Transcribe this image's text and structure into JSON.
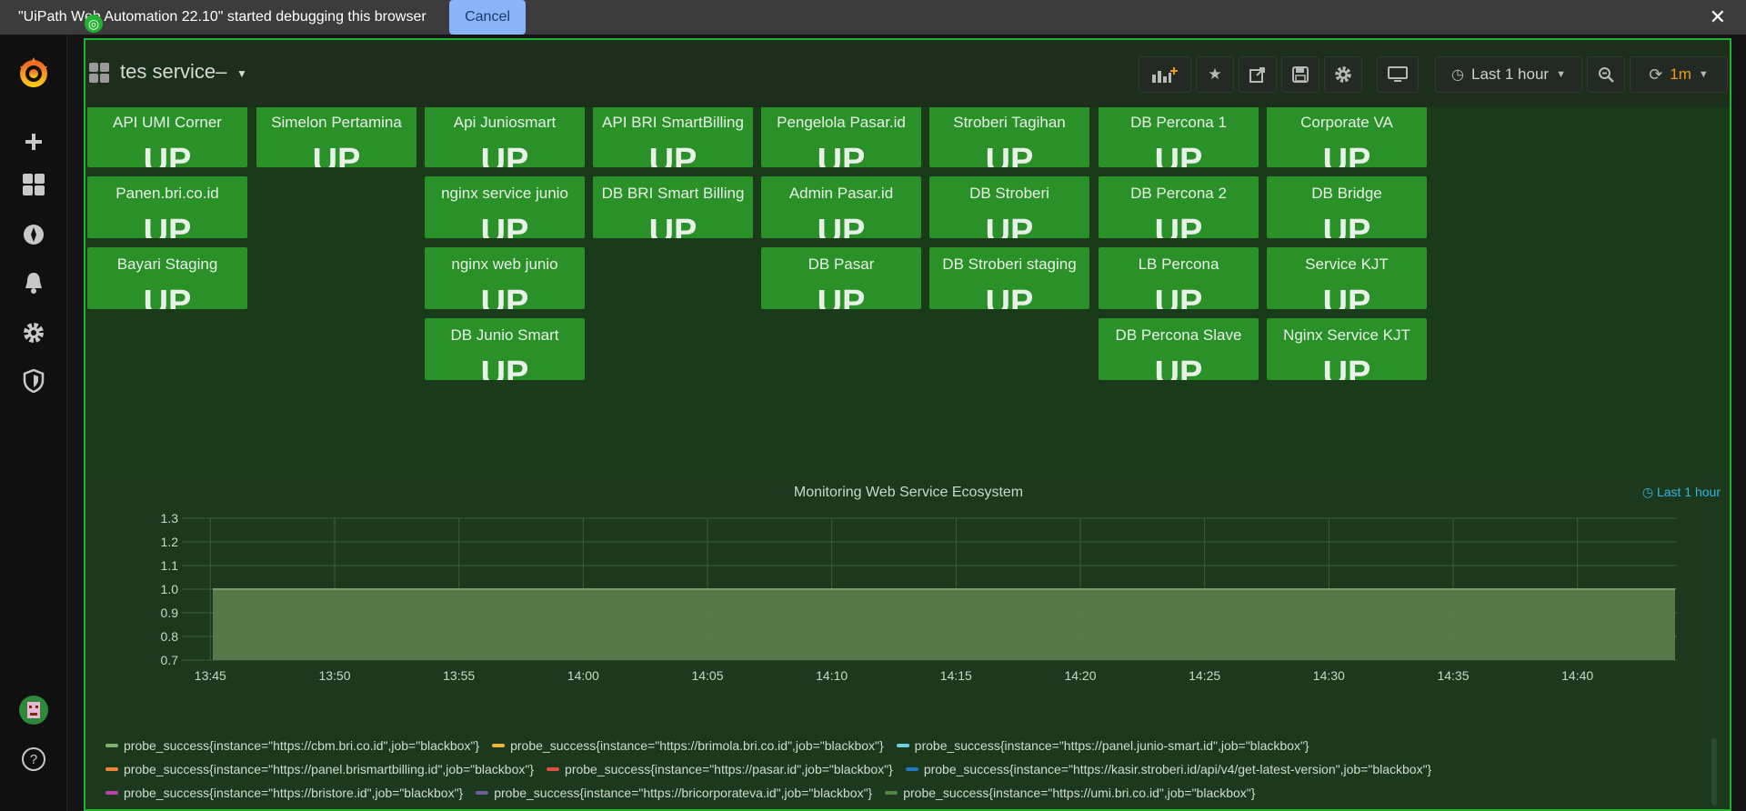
{
  "banner": {
    "message": "\"UiPath Web Automation 22.10\" started debugging this browser",
    "cancel_label": "Cancel",
    "close_label": "✕"
  },
  "navbar": {
    "dashboard_title": "tes service–",
    "time_range_label": "Last 1 hour",
    "refresh_interval": "1m"
  },
  "panels": [
    {
      "title": "",
      "value": "UP"
    },
    {
      "title": "",
      "value": "UP"
    },
    {
      "title": "",
      "value": "UP"
    },
    {
      "title": "",
      "value": "UP"
    },
    {
      "title": "",
      "value": "UP"
    },
    {
      "title": "",
      "value": "UP"
    },
    {
      "title": "",
      "value": "UP"
    },
    {
      "title": "",
      "value": "UP"
    },
    {
      "title": "API UMI Corner",
      "value": "UP"
    },
    {
      "title": "Simelon Pertamina",
      "value": "UP"
    },
    {
      "title": "Api Juniosmart",
      "value": "UP"
    },
    {
      "title": "API BRI SmartBilling",
      "value": "UP"
    },
    {
      "title": "Pengelola Pasar.id",
      "value": "UP"
    },
    {
      "title": "Stroberi Tagihan",
      "value": "UP"
    },
    {
      "title": "DB Percona 1",
      "value": "UP"
    },
    {
      "title": "Corporate VA",
      "value": "UP"
    },
    {
      "title": "Panen.bri.co.id",
      "value": "UP"
    },
    {
      "title": "nginx service junio",
      "value": "UP"
    },
    {
      "title": "DB BRI Smart Billing",
      "value": "UP"
    },
    {
      "title": "Admin Pasar.id",
      "value": "UP"
    },
    {
      "title": "DB Stroberi",
      "value": "UP"
    },
    {
      "title": "DB Percona 2",
      "value": "UP"
    },
    {
      "title": "DB Bridge",
      "value": "UP"
    },
    {
      "title": "Bayari Staging",
      "value": "UP"
    },
    {
      "title": "nginx web junio",
      "value": "UP"
    },
    {
      "title": "DB Pasar",
      "value": "UP"
    },
    {
      "title": "DB Stroberi staging",
      "value": "UP"
    },
    {
      "title": "LB Percona",
      "value": "UP"
    },
    {
      "title": "Service KJT",
      "value": "UP"
    },
    {
      "title": "DB Junio Smart",
      "value": "UP"
    },
    {
      "title": "DB Percona Slave",
      "value": "UP"
    },
    {
      "title": "Nginx Service KJT",
      "value": "UP"
    }
  ],
  "graph": {
    "title": "Monitoring Web Service Ecosystem",
    "range_label": "Last 1 hour",
    "fill_color": "#5a7a4a",
    "legend": [
      {
        "label": "probe_success{instance=\"https://cbm.bri.co.id\",job=\"blackbox\"}",
        "color": "#7eb26d"
      },
      {
        "label": "probe_success{instance=\"https://brimola.bri.co.id\",job=\"blackbox\"}",
        "color": "#eab839"
      },
      {
        "label": "probe_success{instance=\"https://panel.junio-smart.id\",job=\"blackbox\"}",
        "color": "#6ed0e0"
      },
      {
        "label": "probe_success{instance=\"https://panel.brismartbilling.id\",job=\"blackbox\"}",
        "color": "#ef843c"
      },
      {
        "label": "probe_success{instance=\"https://pasar.id\",job=\"blackbox\"}",
        "color": "#e24d42"
      },
      {
        "label": "probe_success{instance=\"https://kasir.stroberi.id/api/v4/get-latest-version\",job=\"blackbox\"}",
        "color": "#1f78c1"
      },
      {
        "label": "probe_success{instance=\"https://bristore.id\",job=\"blackbox\"}",
        "color": "#ba43a9"
      },
      {
        "label": "probe_success{instance=\"https://bricorporateva.id\",job=\"blackbox\"}",
        "color": "#705da0"
      },
      {
        "label": "probe_success{instance=\"https://umi.bri.co.id\",job=\"blackbox\"}",
        "color": "#508642"
      }
    ]
  },
  "chart_data": {
    "type": "area",
    "title": "Monitoring Web Service Ecosystem",
    "x_ticks": [
      "13:45",
      "13:50",
      "13:55",
      "14:00",
      "14:05",
      "14:10",
      "14:15",
      "14:20",
      "14:25",
      "14:30",
      "14:35",
      "14:40"
    ],
    "y_ticks": [
      "1.3",
      "1.2",
      "1.1",
      "1.0",
      "0.9",
      "0.8",
      "0.7"
    ],
    "ylim": [
      0.7,
      1.3
    ],
    "grid": true,
    "x": [
      "13:44",
      "14:44"
    ],
    "series_value": 1.0
  }
}
